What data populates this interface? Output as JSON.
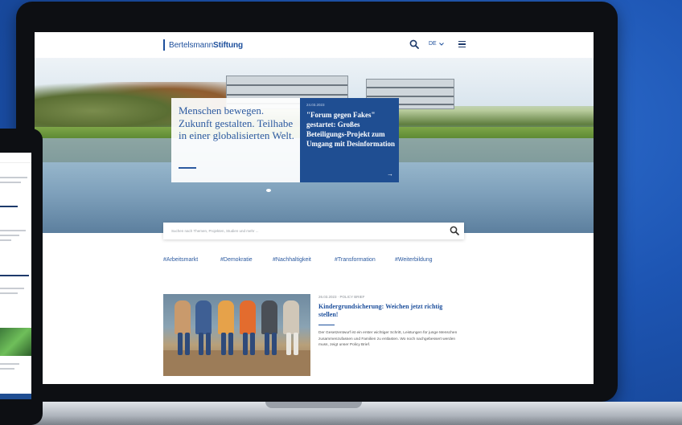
{
  "header": {
    "logo_regular": "Bertelsmann",
    "logo_bold": "Stiftung",
    "language": "DE"
  },
  "hero": {
    "slogan": "Menschen bewegen. Zukunft gestalten. Teilhabe in einer globalisierten Welt.",
    "feature_date": "24.03.2023",
    "feature_title": "\"Forum gegen Fakes\" gestartet: Großes Beteiligungs-Projekt zum Umgang mit Desinformation",
    "feature_arrow": "→"
  },
  "search": {
    "placeholder": "Suchen nach Themen, Projekten, Studien und mehr ..."
  },
  "tags": [
    "#Arbeitsmarkt",
    "#Demokratie",
    "#Nachhaltigkeit",
    "#Transformation",
    "#Weiterbildung"
  ],
  "article": {
    "meta": "26.03.2023 · POLICY BRIEF",
    "title": "Kindergrundsicherung: Weichen jetzt richtig stellen!",
    "body": "Der Gesetzentwurf ist ein erster wichtiger Schritt, Leistungen für junge Menschen zusammenzufassen und Familien zu entlasten. Wo noch nachgebessert werden muss, zeigt unser Policy Brief."
  },
  "icons": {
    "search": "search-icon",
    "menu": "hamburger-menu-icon",
    "chevron": "chevron-down-icon"
  },
  "colors": {
    "brand_blue": "#1d4f9c",
    "feature_card": "#1f4e92",
    "background": "#1d55b3"
  }
}
